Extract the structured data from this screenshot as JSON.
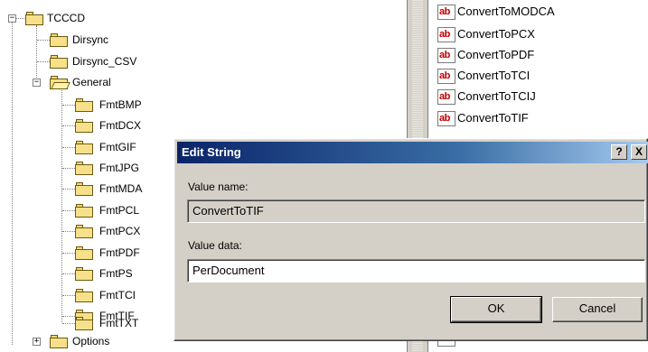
{
  "tree": {
    "root": {
      "label": "TCCCD",
      "expander": "−"
    },
    "children_top": [
      {
        "label": "Dirsync"
      },
      {
        "label": "Dirsync_CSV"
      }
    ],
    "general": {
      "label": "General",
      "expander": "−"
    },
    "general_items": [
      {
        "label": "FmtBMP"
      },
      {
        "label": "FmtDCX"
      },
      {
        "label": "FmtGIF"
      },
      {
        "label": "FmtJPG"
      },
      {
        "label": "FmtMDA"
      },
      {
        "label": "FmtPCL"
      },
      {
        "label": "FmtPCX"
      },
      {
        "label": "FmtPDF"
      },
      {
        "label": "FmtPS"
      },
      {
        "label": "FmtTCI"
      },
      {
        "label": "FmtTIF"
      },
      {
        "label": "FmtTXT"
      }
    ],
    "options": {
      "label": "Options",
      "expander": "+"
    }
  },
  "values_pane": {
    "icon_text": "ab",
    "items": [
      {
        "name": "ConvertToMODCA"
      },
      {
        "name": "ConvertToPCX"
      },
      {
        "name": "ConvertToPDF"
      },
      {
        "name": "ConvertToTCI"
      },
      {
        "name": "ConvertToTCIJ"
      },
      {
        "name": "ConvertToTIF"
      }
    ]
  },
  "dialog": {
    "title": "Edit String",
    "help_glyph": "?",
    "close_glyph": "X",
    "value_name_label": "Value name:",
    "value_name": "ConvertToTIF",
    "value_data_label": "Value data:",
    "value_data": "PerDocument",
    "ok_label": "OK",
    "cancel_label": "Cancel"
  },
  "colors": {
    "titlebar_start": "#0a246a",
    "titlebar_end": "#a6caf0",
    "dialog_face": "#d4d0c8",
    "folder_yellow": "#f7e08a",
    "string_icon_red": "#c00000"
  }
}
